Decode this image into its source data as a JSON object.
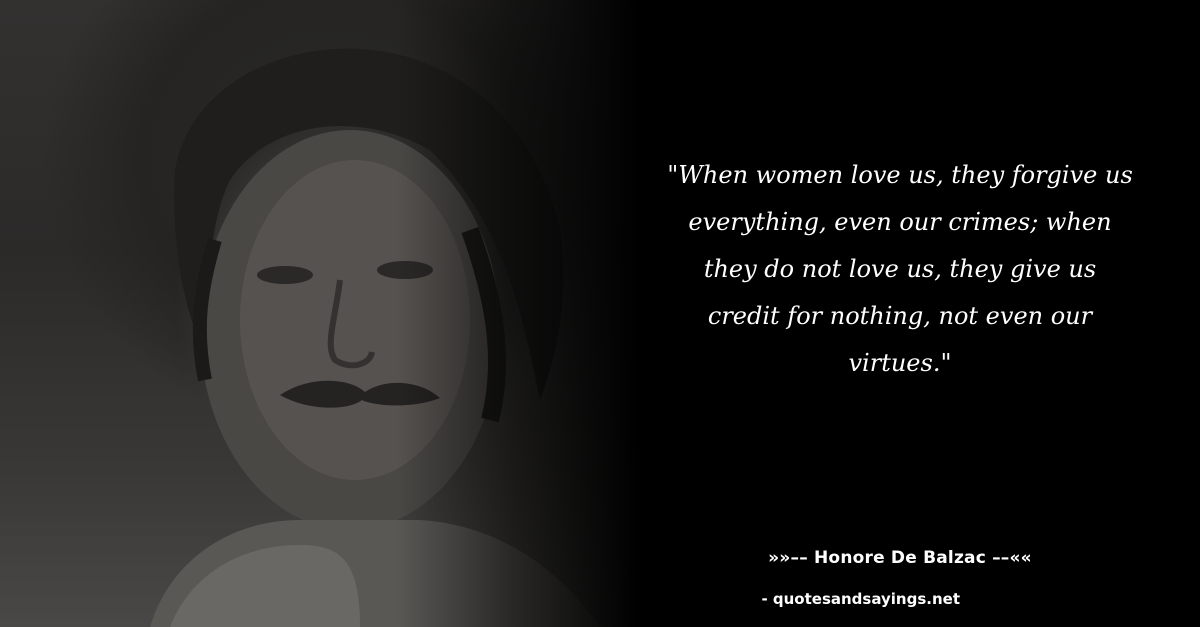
{
  "quote": {
    "lines": [
      "\"When women love us, they forgive us",
      "everything, even our crimes; when",
      "they do not love us, they give us",
      "credit for nothing, not even our",
      "virtues.\""
    ]
  },
  "author": "»»–– Honore De Balzac ––««",
  "source": "- quotesandsayings.net",
  "portrait": {
    "icon": "author-portrait"
  }
}
